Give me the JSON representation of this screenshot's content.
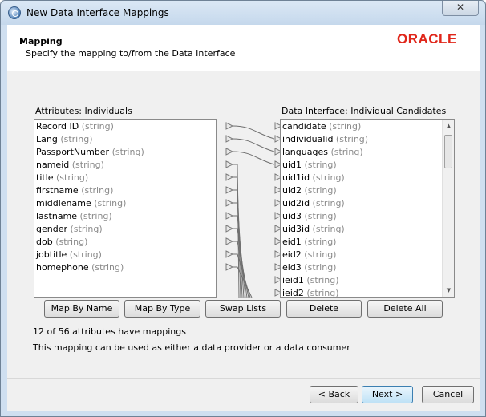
{
  "window": {
    "title": "New Data Interface Mappings",
    "close_label": "✕"
  },
  "header": {
    "title": "Mapping",
    "subtitle": "Specify the mapping to/from the Data Interface",
    "logo": "ORACLE"
  },
  "left_list": {
    "label": "Attributes: Individuals",
    "items": [
      {
        "name": "Record ID",
        "type": "(string)"
      },
      {
        "name": "Lang",
        "type": "(string)"
      },
      {
        "name": "PassportNumber",
        "type": "(string)"
      },
      {
        "name": "nameid",
        "type": "(string)"
      },
      {
        "name": "title",
        "type": "(string)"
      },
      {
        "name": "firstname",
        "type": "(string)"
      },
      {
        "name": "middlename",
        "type": "(string)"
      },
      {
        "name": "lastname",
        "type": "(string)"
      },
      {
        "name": "gender",
        "type": "(string)"
      },
      {
        "name": "dob",
        "type": "(string)"
      },
      {
        "name": "jobtitle",
        "type": "(string)"
      },
      {
        "name": "homephone",
        "type": "(string)"
      }
    ]
  },
  "right_list": {
    "label": "Data Interface: Individual Candidates",
    "items": [
      {
        "name": "candidate",
        "type": "(string)"
      },
      {
        "name": "individualid",
        "type": "(string)"
      },
      {
        "name": "languages",
        "type": "(string)"
      },
      {
        "name": "uid1",
        "type": "(string)"
      },
      {
        "name": "uid1id",
        "type": "(string)"
      },
      {
        "name": "uid2",
        "type": "(string)"
      },
      {
        "name": "uid2id",
        "type": "(string)"
      },
      {
        "name": "uid3",
        "type": "(string)"
      },
      {
        "name": "uid3id",
        "type": "(string)"
      },
      {
        "name": "eid1",
        "type": "(string)"
      },
      {
        "name": "eid2",
        "type": "(string)"
      },
      {
        "name": "eid3",
        "type": "(string)"
      },
      {
        "name": "ieid1",
        "type": "(string)"
      },
      {
        "name": "ieid2",
        "type": "(string)"
      }
    ]
  },
  "actions": {
    "map_by_name": "Map By Name",
    "map_by_type": "Map By Type",
    "swap_lists": "Swap Lists",
    "delete": "Delete",
    "delete_all": "Delete All"
  },
  "status": {
    "mapping_count": "12 of 56 attributes have mappings",
    "usage": "This mapping can be used as either a data provider or a data consumer"
  },
  "footer": {
    "back": "< Back",
    "next": "Next >",
    "cancel": "Cancel"
  }
}
